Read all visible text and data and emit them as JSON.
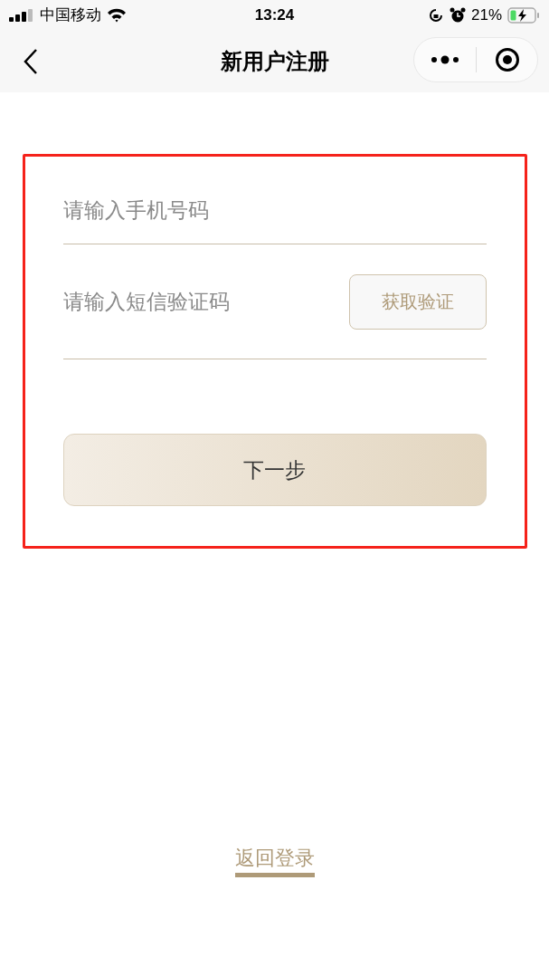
{
  "status_bar": {
    "carrier": "中国移动",
    "time": "13:24",
    "battery": "21%"
  },
  "nav": {
    "title": "新用户注册"
  },
  "form": {
    "phone": {
      "placeholder": "请输入手机号码"
    },
    "code": {
      "placeholder": "请输入短信验证码"
    },
    "get_code_button": "获取验证",
    "next_button": "下一步"
  },
  "back_link": "返回登录"
}
